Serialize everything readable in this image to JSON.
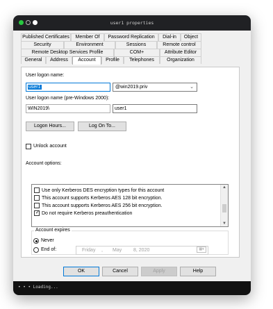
{
  "window": {
    "title": "user1 properties"
  },
  "tabs": {
    "row1": [
      "Published Certificates",
      "Member Of",
      "Password Replication",
      "Dial-in",
      "Object"
    ],
    "row2": [
      "Security",
      "Environment",
      "Sessions",
      "Remote control"
    ],
    "row3": [
      "Remote Desktop Services Profile",
      "COM+",
      "Attribute Editor"
    ],
    "row4": [
      "General",
      "Address",
      "Account",
      "Profile",
      "Telephones",
      "Organization"
    ],
    "active": "Account"
  },
  "account": {
    "logon_name_label": "User logon name:",
    "logon_name_value": "user1",
    "domain_value": "@win2019.priv",
    "pre2000_label": "User logon name (pre-Windows 2000):",
    "pre2000_domain": "WIN2019\\",
    "pre2000_user": "user1",
    "logon_hours_button": "Logon Hours...",
    "log_on_to_button": "Log On To...",
    "unlock_label": "Unlock account",
    "options_label": "Account options:",
    "options": [
      {
        "label": "Use only Kerberos DES encryption types for this account",
        "checked": false
      },
      {
        "label": "This account supports Kerberos AES 128 bit encryption.",
        "checked": false
      },
      {
        "label": "This account supports Kerberos AES 256 bit encryption.",
        "checked": false
      },
      {
        "label": "Do not require Kerberos preauthentication",
        "checked": true
      }
    ],
    "expires": {
      "title": "Account expires",
      "never_label": "Never",
      "end_of_label": "End of:",
      "selected": "Never",
      "date": {
        "weekday": "Friday",
        "sep": ",",
        "month": "May",
        "day": "8, 2020"
      }
    }
  },
  "buttons": {
    "ok": "OK",
    "cancel": "Cancel",
    "apply": "Apply",
    "help": "Help"
  },
  "status": {
    "text": "• • • Loading..."
  }
}
